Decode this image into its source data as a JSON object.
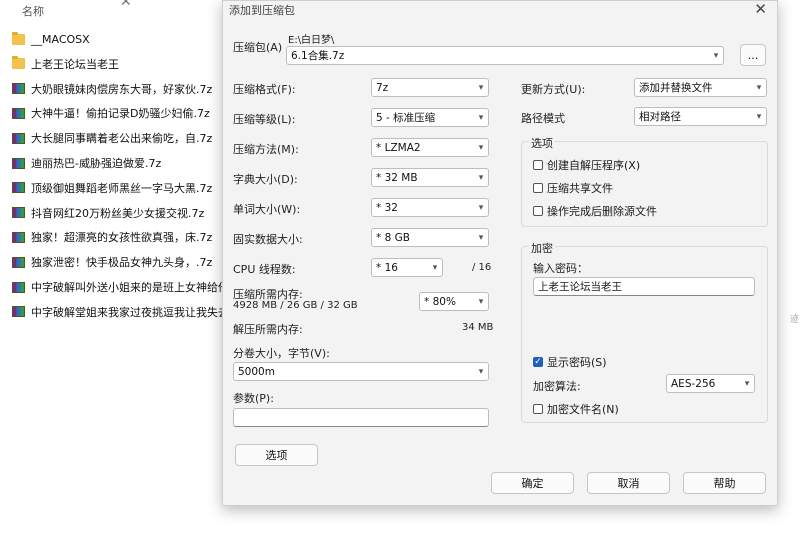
{
  "explorer": {
    "column_header": "名称",
    "files": [
      {
        "name": "__MACOSX",
        "type": "folder"
      },
      {
        "name": "上老王论坛当老王",
        "type": "folder"
      },
      {
        "name": "大奶眼镜妹肉偿房东大哥，好家伙.7z",
        "type": "archive"
      },
      {
        "name": "大神牛逼！偷拍记录D奶骚少妇偷.7z",
        "type": "archive"
      },
      {
        "name": "大长腿同事瞒着老公出来偷吃，自.7z",
        "type": "archive"
      },
      {
        "name": "迪丽热巴-威胁强迫做爱.7z",
        "type": "archive"
      },
      {
        "name": "顶级御姐舞蹈老师黑丝一字马大黑.7z",
        "type": "archive"
      },
      {
        "name": "抖音网红20万粉丝美少女援交视.7z",
        "type": "archive"
      },
      {
        "name": "独家！超漂亮的女孩性欲真强，床.7z",
        "type": "archive"
      },
      {
        "name": "独家泄密！快手极品女神九头身，.7z",
        "type": "archive"
      },
      {
        "name": "中字破解叫外送小姐来的是班上女神给他",
        "type": "archive"
      },
      {
        "name": "中字破解堂姐来我家过夜挑逗我让我失去",
        "type": "archive"
      }
    ],
    "side_fragment": "迹"
  },
  "dialog": {
    "title": "添加到压缩包",
    "close_glyph": "✕",
    "archive_label": "压缩包(A)",
    "archive_path": "E:\\白日梦\\",
    "archive_name": "6.1合集.7z",
    "browse_label": "...",
    "format_label": "压缩格式(F):",
    "format_value": "7z",
    "level_label": "压缩等级(L):",
    "level_value": "5 - 标准压缩",
    "method_label": "压缩方法(M):",
    "method_value": "*  LZMA2",
    "dict_label": "字典大小(D):",
    "dict_value": "*  32 MB",
    "word_label": "单词大小(W):",
    "word_value": "*  32",
    "solid_label": "固实数据大小:",
    "solid_value": "*  8 GB",
    "threads_label": "CPU 线程数:",
    "threads_value": "*  16",
    "threads_total": "/ 16",
    "mem_compress_label": "压缩所需内存:",
    "mem_compress_detail": "4928 MB / 26 GB / 32 GB",
    "mem_percent_value": "*  80%",
    "mem_decompress_label": "解压所需内存:",
    "mem_decompress_value": "34 MB",
    "volume_label": "分卷大小，字节(V):",
    "volume_value": "5000m",
    "params_label": "参数(P):",
    "params_value": "",
    "options_button": "选项",
    "update_label": "更新方式(U):",
    "update_value": "添加并替换文件",
    "path_label": "路径模式",
    "path_value": "相对路径",
    "options_group_title": "选项",
    "opt_sfx": "创建自解压程序(X)",
    "opt_shared": "压缩共享文件",
    "opt_delete": "操作完成后删除源文件",
    "encrypt_group_title": "加密",
    "password_label": "输入密码：",
    "password_value": "上老王论坛当老王",
    "show_password_label": "显示密码(S)",
    "show_password_checked": true,
    "encrypt_method_label": "加密算法:",
    "encrypt_method_value": "AES-256",
    "encrypt_names_label": "加密文件名(N)",
    "ok_label": "确定",
    "cancel_label": "取消",
    "help_label": "帮助"
  },
  "icons": {
    "dropdown": "▾",
    "check": "✓"
  }
}
